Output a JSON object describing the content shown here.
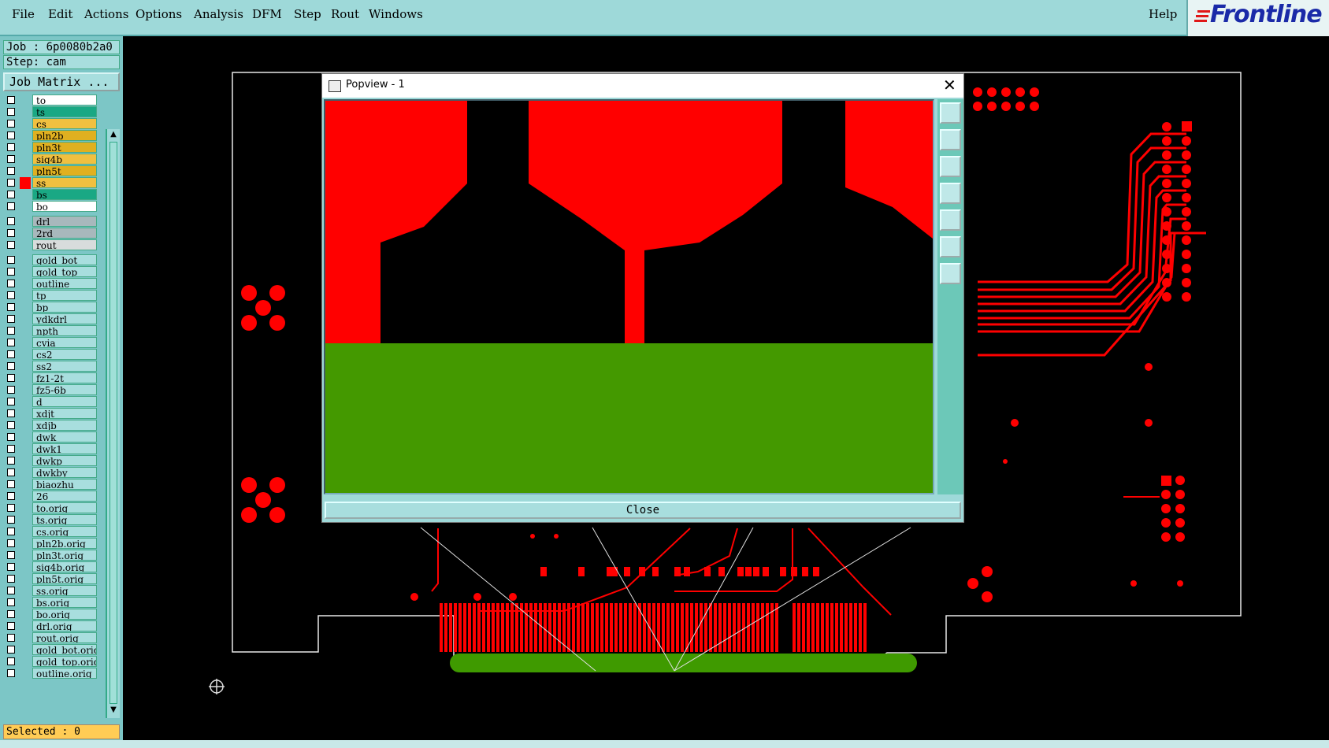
{
  "menubar": {
    "items": [
      "File",
      "Edit",
      "Actions",
      "Options",
      "Analysis",
      "DFM",
      "Step",
      "Rout",
      "Windows"
    ],
    "help": "Help",
    "brand": "Frontline"
  },
  "job": {
    "job_text": "Job : 6p0080b2a0",
    "step_text": "Step: cam",
    "matrix_button": "Job Matrix ..."
  },
  "layers": {
    "board": [
      {
        "name": "to",
        "color": "#ffffff"
      },
      {
        "name": "ts",
        "color": "#1aa884"
      },
      {
        "name": "cs",
        "color": "#f0c040"
      },
      {
        "name": "pln2b",
        "color": "#e0b020"
      },
      {
        "name": "pln3t",
        "color": "#e0b020"
      },
      {
        "name": "sig4b",
        "color": "#f0c040"
      },
      {
        "name": "pln5t",
        "color": "#e0b020"
      },
      {
        "name": "ss",
        "color": "#f0c040"
      },
      {
        "name": "bs",
        "color": "#1aa884"
      },
      {
        "name": "bo",
        "color": "#ffffff"
      }
    ],
    "drill": [
      {
        "name": "drl",
        "color": "#a8b8bc"
      },
      {
        "name": "2rd",
        "color": "#a8b8bc"
      },
      {
        "name": "rout",
        "color": "#d8dcdc"
      }
    ],
    "misc": [
      "gold_bot",
      "gold_top",
      "outline",
      "tp",
      "bp",
      "ydkdrl",
      "npth",
      "cvia",
      "cs2",
      "ss2",
      "fz1-2t",
      "fz5-6b",
      "d",
      "xdjt",
      "xdjb",
      "dwk",
      "dwk1",
      "dwkp",
      "dwkby",
      "biaozhu",
      "26",
      "to.orig",
      "ts.orig",
      "cs.orig",
      "pln2b.orig",
      "pln3t.orig",
      "sig4b.orig",
      "pln5t.orig",
      "ss.orig",
      "bs.orig",
      "bo.orig",
      "drl.orig",
      "rout.orig",
      "gold_bot.orig",
      "gold_top.orig",
      "outline.orig"
    ],
    "misc_color": "#a8dede"
  },
  "selected": "Selected : 0",
  "popview": {
    "title": "Popview - 1",
    "close_label": "Close"
  },
  "colors": {
    "copper": "#ff0000",
    "gold": "#3f9a00",
    "menubar": "#9ed9d9"
  },
  "tool_icons": [
    "window-zoom-icon",
    "pan-up-icon",
    "pan-down-icon",
    "pan-left-icon",
    "pan-right-icon",
    "zoom-fit-icon",
    "zoom-reset-icon"
  ]
}
